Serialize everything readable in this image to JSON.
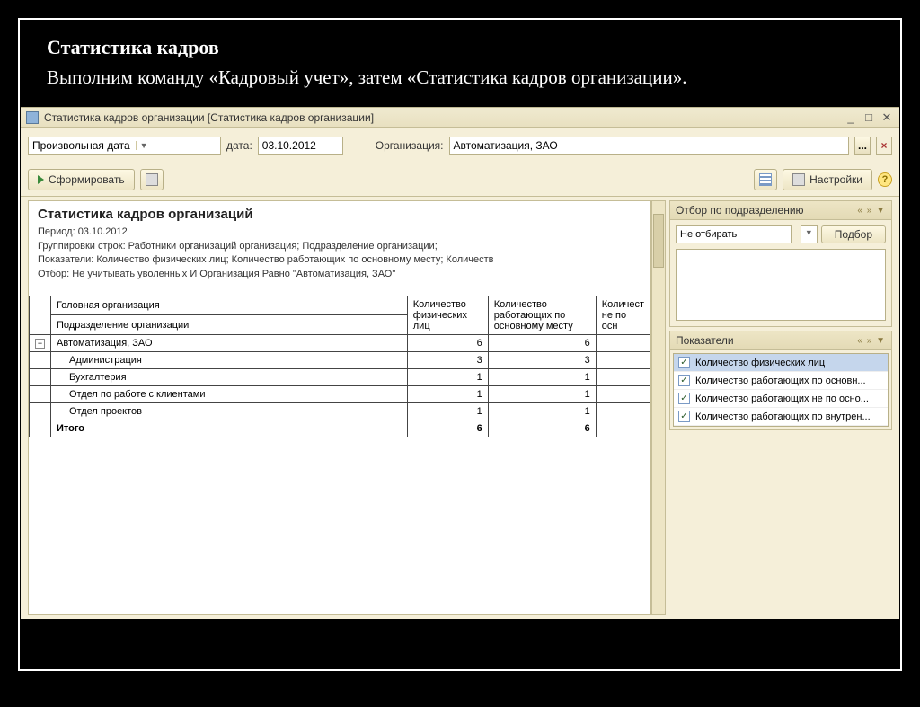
{
  "slide": {
    "title": "Статистика кадров",
    "subtitle": "Выполним команду «Кадровый учет», затем «Статистика кадров организации»."
  },
  "window": {
    "title": "Статистика кадров организации [Статистика кадров организации]"
  },
  "filters": {
    "period_type": "Произвольная дата",
    "date_label": "дата:",
    "date": "03.10.2012",
    "org_label": "Организация:",
    "org": "Автоматизация, ЗАО"
  },
  "toolbar": {
    "generate": "Сформировать",
    "settings": "Настройки"
  },
  "report": {
    "title": "Статистика кадров организаций",
    "period": "Период: 03.10.2012",
    "grouping": "Группировки строк: Работники организаций организация; Подразделение организации;",
    "indicators": "Показатели: Количество физических лиц; Количество работающих по основному месту; Количеств",
    "filter": "Отбор: Не учитывать уволенных И Организация Равно \"Автоматизация, ЗАО\"",
    "col1a": "Головная организация",
    "col1b": "Подразделение организации",
    "col2": "Количество физических лиц",
    "col3": "Количество работающих по основному месту",
    "col4": "Количест не по осн",
    "rows": [
      {
        "name": "Автоматизация, ЗАО",
        "v1": "6",
        "v2": "6",
        "indent": 0,
        "tree": true
      },
      {
        "name": "Администрация",
        "v1": "3",
        "v2": "3",
        "indent": 1
      },
      {
        "name": "Бухгалтерия",
        "v1": "1",
        "v2": "1",
        "indent": 1
      },
      {
        "name": "Отдел по работе с клиентами",
        "v1": "1",
        "v2": "1",
        "indent": 1
      },
      {
        "name": "Отдел проектов",
        "v1": "1",
        "v2": "1",
        "indent": 1
      }
    ],
    "total_label": "Итого",
    "total_v1": "6",
    "total_v2": "6"
  },
  "side": {
    "filter_panel": "Отбор по подразделению",
    "filter_value": "Не отбирать",
    "pick": "Подбор",
    "indicators_panel": "Показатели",
    "indicators": [
      "Количество физических лиц",
      "Количество работающих по основн...",
      "Количество работающих не по осно...",
      "Количество работающих по внутрен..."
    ]
  }
}
